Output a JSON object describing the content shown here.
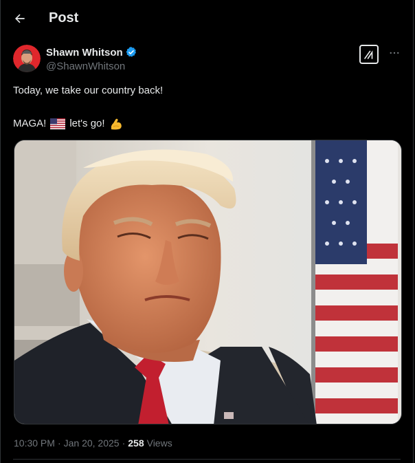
{
  "header": {
    "title": "Post"
  },
  "author": {
    "display_name": "Shawn Whitson",
    "handle": "@ShawnWhitson",
    "verified": true
  },
  "post": {
    "line1": "Today, we take our country back!",
    "line2_prefix": "MAGA!",
    "line2_mid": "let's go!",
    "emoji_flag": "us-flag-emoji",
    "emoji_flex": "flexed-biceps-emoji"
  },
  "meta": {
    "time": "10:30 PM",
    "sep1": "·",
    "date": "Jan 20, 2025",
    "sep2": "·",
    "views": "258",
    "views_label": "Views"
  },
  "colors": {
    "background": "#000000",
    "text": "#e7e9ea",
    "muted": "#71767b",
    "verified": "#1d9bf0",
    "border": "#2f3336",
    "avatar_bg": "#e0272c"
  }
}
